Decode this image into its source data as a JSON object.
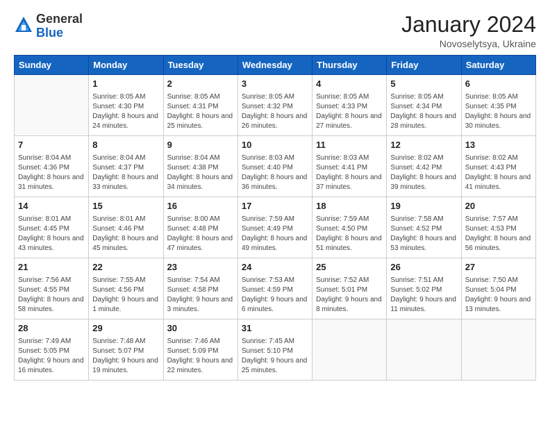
{
  "header": {
    "logo_general": "General",
    "logo_blue": "Blue",
    "title": "January 2024",
    "subtitle": "Novoselytsya, Ukraine"
  },
  "calendar": {
    "weekdays": [
      "Sunday",
      "Monday",
      "Tuesday",
      "Wednesday",
      "Thursday",
      "Friday",
      "Saturday"
    ],
    "weeks": [
      [
        {
          "day": "",
          "sunrise": "",
          "sunset": "",
          "daylight": ""
        },
        {
          "day": "1",
          "sunrise": "Sunrise: 8:05 AM",
          "sunset": "Sunset: 4:30 PM",
          "daylight": "Daylight: 8 hours and 24 minutes."
        },
        {
          "day": "2",
          "sunrise": "Sunrise: 8:05 AM",
          "sunset": "Sunset: 4:31 PM",
          "daylight": "Daylight: 8 hours and 25 minutes."
        },
        {
          "day": "3",
          "sunrise": "Sunrise: 8:05 AM",
          "sunset": "Sunset: 4:32 PM",
          "daylight": "Daylight: 8 hours and 26 minutes."
        },
        {
          "day": "4",
          "sunrise": "Sunrise: 8:05 AM",
          "sunset": "Sunset: 4:33 PM",
          "daylight": "Daylight: 8 hours and 27 minutes."
        },
        {
          "day": "5",
          "sunrise": "Sunrise: 8:05 AM",
          "sunset": "Sunset: 4:34 PM",
          "daylight": "Daylight: 8 hours and 28 minutes."
        },
        {
          "day": "6",
          "sunrise": "Sunrise: 8:05 AM",
          "sunset": "Sunset: 4:35 PM",
          "daylight": "Daylight: 8 hours and 30 minutes."
        }
      ],
      [
        {
          "day": "7",
          "sunrise": "Sunrise: 8:04 AM",
          "sunset": "Sunset: 4:36 PM",
          "daylight": "Daylight: 8 hours and 31 minutes."
        },
        {
          "day": "8",
          "sunrise": "Sunrise: 8:04 AM",
          "sunset": "Sunset: 4:37 PM",
          "daylight": "Daylight: 8 hours and 33 minutes."
        },
        {
          "day": "9",
          "sunrise": "Sunrise: 8:04 AM",
          "sunset": "Sunset: 4:38 PM",
          "daylight": "Daylight: 8 hours and 34 minutes."
        },
        {
          "day": "10",
          "sunrise": "Sunrise: 8:03 AM",
          "sunset": "Sunset: 4:40 PM",
          "daylight": "Daylight: 8 hours and 36 minutes."
        },
        {
          "day": "11",
          "sunrise": "Sunrise: 8:03 AM",
          "sunset": "Sunset: 4:41 PM",
          "daylight": "Daylight: 8 hours and 37 minutes."
        },
        {
          "day": "12",
          "sunrise": "Sunrise: 8:02 AM",
          "sunset": "Sunset: 4:42 PM",
          "daylight": "Daylight: 8 hours and 39 minutes."
        },
        {
          "day": "13",
          "sunrise": "Sunrise: 8:02 AM",
          "sunset": "Sunset: 4:43 PM",
          "daylight": "Daylight: 8 hours and 41 minutes."
        }
      ],
      [
        {
          "day": "14",
          "sunrise": "Sunrise: 8:01 AM",
          "sunset": "Sunset: 4:45 PM",
          "daylight": "Daylight: 8 hours and 43 minutes."
        },
        {
          "day": "15",
          "sunrise": "Sunrise: 8:01 AM",
          "sunset": "Sunset: 4:46 PM",
          "daylight": "Daylight: 8 hours and 45 minutes."
        },
        {
          "day": "16",
          "sunrise": "Sunrise: 8:00 AM",
          "sunset": "Sunset: 4:48 PM",
          "daylight": "Daylight: 8 hours and 47 minutes."
        },
        {
          "day": "17",
          "sunrise": "Sunrise: 7:59 AM",
          "sunset": "Sunset: 4:49 PM",
          "daylight": "Daylight: 8 hours and 49 minutes."
        },
        {
          "day": "18",
          "sunrise": "Sunrise: 7:59 AM",
          "sunset": "Sunset: 4:50 PM",
          "daylight": "Daylight: 8 hours and 51 minutes."
        },
        {
          "day": "19",
          "sunrise": "Sunrise: 7:58 AM",
          "sunset": "Sunset: 4:52 PM",
          "daylight": "Daylight: 8 hours and 53 minutes."
        },
        {
          "day": "20",
          "sunrise": "Sunrise: 7:57 AM",
          "sunset": "Sunset: 4:53 PM",
          "daylight": "Daylight: 8 hours and 56 minutes."
        }
      ],
      [
        {
          "day": "21",
          "sunrise": "Sunrise: 7:56 AM",
          "sunset": "Sunset: 4:55 PM",
          "daylight": "Daylight: 8 hours and 58 minutes."
        },
        {
          "day": "22",
          "sunrise": "Sunrise: 7:55 AM",
          "sunset": "Sunset: 4:56 PM",
          "daylight": "Daylight: 9 hours and 1 minute."
        },
        {
          "day": "23",
          "sunrise": "Sunrise: 7:54 AM",
          "sunset": "Sunset: 4:58 PM",
          "daylight": "Daylight: 9 hours and 3 minutes."
        },
        {
          "day": "24",
          "sunrise": "Sunrise: 7:53 AM",
          "sunset": "Sunset: 4:59 PM",
          "daylight": "Daylight: 9 hours and 6 minutes."
        },
        {
          "day": "25",
          "sunrise": "Sunrise: 7:52 AM",
          "sunset": "Sunset: 5:01 PM",
          "daylight": "Daylight: 9 hours and 8 minutes."
        },
        {
          "day": "26",
          "sunrise": "Sunrise: 7:51 AM",
          "sunset": "Sunset: 5:02 PM",
          "daylight": "Daylight: 9 hours and 11 minutes."
        },
        {
          "day": "27",
          "sunrise": "Sunrise: 7:50 AM",
          "sunset": "Sunset: 5:04 PM",
          "daylight": "Daylight: 9 hours and 13 minutes."
        }
      ],
      [
        {
          "day": "28",
          "sunrise": "Sunrise: 7:49 AM",
          "sunset": "Sunset: 5:05 PM",
          "daylight": "Daylight: 9 hours and 16 minutes."
        },
        {
          "day": "29",
          "sunrise": "Sunrise: 7:48 AM",
          "sunset": "Sunset: 5:07 PM",
          "daylight": "Daylight: 9 hours and 19 minutes."
        },
        {
          "day": "30",
          "sunrise": "Sunrise: 7:46 AM",
          "sunset": "Sunset: 5:09 PM",
          "daylight": "Daylight: 9 hours and 22 minutes."
        },
        {
          "day": "31",
          "sunrise": "Sunrise: 7:45 AM",
          "sunset": "Sunset: 5:10 PM",
          "daylight": "Daylight: 9 hours and 25 minutes."
        },
        {
          "day": "",
          "sunrise": "",
          "sunset": "",
          "daylight": ""
        },
        {
          "day": "",
          "sunrise": "",
          "sunset": "",
          "daylight": ""
        },
        {
          "day": "",
          "sunrise": "",
          "sunset": "",
          "daylight": ""
        }
      ]
    ]
  }
}
